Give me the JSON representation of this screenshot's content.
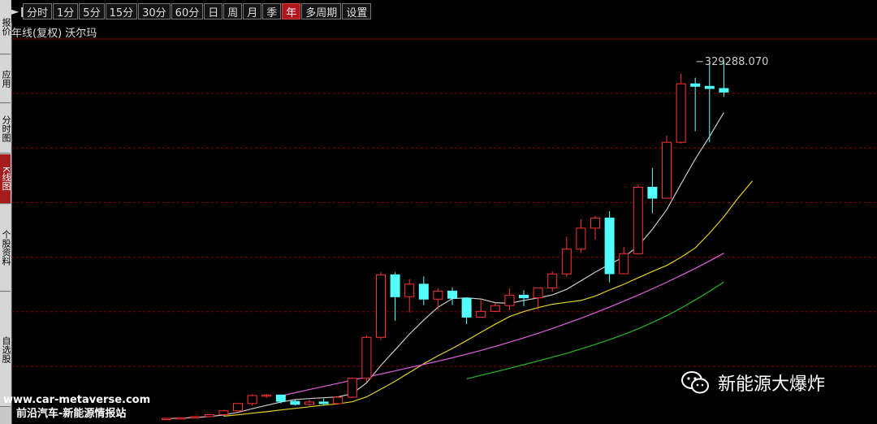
{
  "sidebar": {
    "tabs": [
      {
        "label": "报价",
        "active": false
      },
      {
        "label": "应用",
        "active": false
      },
      {
        "label": "分时图",
        "active": false
      },
      {
        "label": "K线图",
        "active": true
      },
      {
        "label": "个股资料",
        "active": false
      },
      {
        "label": "自选股",
        "active": false
      }
    ]
  },
  "toolbar": {
    "icon": "play-pause-icon",
    "periods": [
      {
        "label": "分时",
        "active": false
      },
      {
        "label": "1分",
        "active": false
      },
      {
        "label": "5分",
        "active": false
      },
      {
        "label": "15分",
        "active": false
      },
      {
        "label": "30分",
        "active": false
      },
      {
        "label": "60分",
        "active": false
      },
      {
        "label": "日",
        "active": false
      },
      {
        "label": "周",
        "active": false
      },
      {
        "label": "月",
        "active": false
      },
      {
        "label": "季",
        "active": false
      },
      {
        "label": "年",
        "active": true
      },
      {
        "label": "多周期",
        "active": false
      },
      {
        "label": "设置",
        "active": false
      }
    ]
  },
  "chart": {
    "title": "年线(复权) 沃尔玛"
  },
  "chart_data": {
    "type": "candlestick",
    "title": "年线(复权) 沃尔玛",
    "max_label": "329288.070",
    "ylim": [
      0,
      350000
    ],
    "colors": {
      "up": "#ff3232",
      "down": "#54ffff",
      "grid": "#8b0000",
      "ma1": "#c8c8c8",
      "ma2": "#e6d21e",
      "ma3": "#e060e0",
      "ma4": "#22b822"
    },
    "candles": [
      {
        "o": 1500,
        "h": 2400,
        "l": 1200,
        "c": 2200
      },
      {
        "o": 2100,
        "h": 3000,
        "l": 1800,
        "c": 2700
      },
      {
        "o": 2700,
        "h": 4200,
        "l": 2300,
        "c": 3800
      },
      {
        "o": 3800,
        "h": 6200,
        "l": 3400,
        "c": 5600
      },
      {
        "o": 5600,
        "h": 10000,
        "l": 5200,
        "c": 9100
      },
      {
        "o": 9100,
        "h": 16600,
        "l": 8600,
        "c": 15800
      },
      {
        "o": 15800,
        "h": 24200,
        "l": 13800,
        "c": 23100
      },
      {
        "o": 23100,
        "h": 24700,
        "l": 20900,
        "c": 23600
      },
      {
        "o": 23600,
        "h": 23900,
        "l": 15900,
        "c": 17800
      },
      {
        "o": 17800,
        "h": 19300,
        "l": 14000,
        "c": 15000
      },
      {
        "o": 15000,
        "h": 19300,
        "l": 13600,
        "c": 17200
      },
      {
        "o": 17200,
        "h": 20500,
        "l": 13800,
        "c": 15700
      },
      {
        "o": 15700,
        "h": 22400,
        "l": 15500,
        "c": 21600
      },
      {
        "o": 21600,
        "h": 39600,
        "l": 20800,
        "c": 38900
      },
      {
        "o": 38900,
        "h": 78400,
        "l": 35800,
        "c": 76500
      },
      {
        "o": 76500,
        "h": 136100,
        "l": 74300,
        "c": 133800
      },
      {
        "o": 133800,
        "h": 136100,
        "l": 91600,
        "c": 113700
      },
      {
        "o": 113700,
        "h": 130000,
        "l": 99300,
        "c": 125200
      },
      {
        "o": 125200,
        "h": 132300,
        "l": 105900,
        "c": 111500
      },
      {
        "o": 111500,
        "h": 121300,
        "l": 102000,
        "c": 118900
      },
      {
        "o": 118900,
        "h": 122400,
        "l": 106000,
        "c": 112300
      },
      {
        "o": 112300,
        "h": 111500,
        "l": 88600,
        "c": 95000
      },
      {
        "o": 95000,
        "h": 110800,
        "l": 96600,
        "c": 100300
      },
      {
        "o": 100300,
        "h": 107600,
        "l": 100000,
        "c": 105600
      },
      {
        "o": 105600,
        "h": 121300,
        "l": 101300,
        "c": 115100
      },
      {
        "o": 115100,
        "h": 119700,
        "l": 105100,
        "c": 112700
      },
      {
        "o": 112700,
        "h": 118900,
        "l": 102000,
        "c": 121700
      },
      {
        "o": 121700,
        "h": 137100,
        "l": 118400,
        "c": 134600
      },
      {
        "o": 134600,
        "h": 168800,
        "l": 131900,
        "c": 157300
      },
      {
        "o": 157300,
        "h": 184500,
        "l": 153900,
        "c": 176600
      },
      {
        "o": 176600,
        "h": 187900,
        "l": 166100,
        "c": 185900
      },
      {
        "o": 185900,
        "h": 192200,
        "l": 126800,
        "c": 134800
      },
      {
        "o": 134800,
        "h": 159400,
        "l": 137600,
        "c": 153200
      },
      {
        "o": 153200,
        "h": 216400,
        "l": 152500,
        "c": 214100
      },
      {
        "o": 214100,
        "h": 231700,
        "l": 190200,
        "c": 204000
      },
      {
        "o": 204000,
        "h": 261200,
        "l": 211000,
        "c": 255300
      },
      {
        "o": 255300,
        "h": 318300,
        "l": 254100,
        "c": 308900
      },
      {
        "o": 308900,
        "h": 314500,
        "l": 265400,
        "c": 306600
      },
      {
        "o": 306600,
        "h": 329288.07,
        "l": 255300,
        "c": 304600
      },
      {
        "o": 304600,
        "h": 329288.07,
        "l": 297000,
        "c": 301300
      }
    ],
    "ma": [
      {
        "start": 0,
        "values": [
          2000,
          2400,
          3000,
          3900,
          5300,
          7700,
          11000,
          14100,
          17100,
          19400,
          20300,
          21100,
          21900,
          24900,
          34700,
          50700,
          65000,
          79400,
          92300,
          104100,
          112000,
          112700,
          111600,
          108300,
          107700,
          110300,
          112600,
          115400,
          120500,
          128300,
          136200,
          143600,
          150000,
          160100,
          175600,
          193500,
          217000,
          239900,
          260600,
          282600
        ]
      },
      {
        "start": 4,
        "values": [
          4200,
          5400,
          6900,
          8300,
          9900,
          11300,
          12800,
          14300,
          15500,
          17400,
          21900,
          29000,
          36200,
          44200,
          52300,
          59600,
          66300,
          73500,
          81100,
          88500,
          95500,
          100100,
          103700,
          106800,
          108600,
          110300,
          114200,
          119900,
          125100,
          131000,
          136900,
          142400,
          149800,
          158500,
          172000,
          187000,
          204300,
          219800
        ]
      },
      {
        "start": 8,
        "values": [
          22800,
          25700,
          28600,
          31500,
          34300,
          37200,
          40000,
          42900,
          45700,
          48700,
          51600,
          54600,
          57700,
          61000,
          64500,
          68200,
          72000,
          76000,
          80200,
          84600,
          89200,
          94000,
          99000,
          104200,
          109600,
          115200,
          121000,
          127000,
          133200,
          139700,
          146500,
          153600
        ]
      },
      {
        "start": 21,
        "values": [
          38400,
          41600,
          44800,
          48100,
          51400,
          54800,
          58300,
          61900,
          65800,
          69900,
          74300,
          79100,
          84300,
          90000,
          96300,
          103200,
          110700,
          118700,
          127200
        ]
      }
    ]
  },
  "watermark": {
    "site": "www.car-metaverse.com",
    "tagline": "前沿汽车-新能源情报站"
  },
  "brand": {
    "icon": "wechat-icon",
    "name": "新能源大爆炸"
  }
}
